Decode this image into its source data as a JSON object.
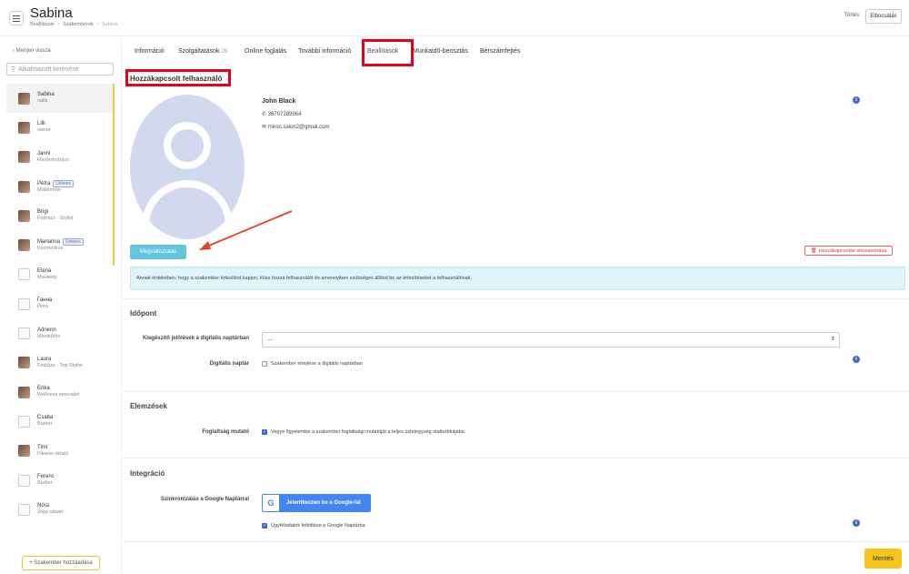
{
  "header": {
    "title": "Sabina",
    "breadcrumbs": [
      "Beállítások",
      "Szakemberek",
      "Sabina"
    ],
    "delete_label": "Törlés",
    "dismiss_label": "Elbocsátás"
  },
  "sidebar": {
    "back_label": "Menjen vissza",
    "search_placeholder": "Alkalmazott keresése",
    "add_label": "+ Szakember hozzáadása",
    "employees": [
      {
        "name": "Sabina",
        "role": "nails",
        "badge": "",
        "photo": true,
        "active": true
      },
      {
        "name": "Lilli",
        "role": "owner",
        "badge": "",
        "photo": true
      },
      {
        "name": "Janni",
        "role": "Mesterfodrász",
        "badge": "",
        "photo": true
      },
      {
        "name": "Petra",
        "role": "Műkörmös",
        "badge": "Üzletes",
        "photo": true
      },
      {
        "name": "Brigi",
        "role": "Fodrász - Stylist",
        "badge": "",
        "photo": true
      },
      {
        "name": "Marianna",
        "role": "Kozmetikus",
        "badge": "Üzletes",
        "photo": true
      },
      {
        "name": "Elena",
        "role": "Манікюр",
        "badge": "",
        "photo": false
      },
      {
        "name": "Ганна",
        "role": "Йога",
        "badge": "",
        "photo": false
      },
      {
        "name": "Adrienn",
        "role": "Manikűrös",
        "badge": "",
        "photo": false
      },
      {
        "name": "Laura",
        "role": "Fodrász - Top Stylist",
        "badge": "",
        "photo": true
      },
      {
        "name": "Erika",
        "role": "Wellness specialist",
        "badge": "",
        "photo": true
      },
      {
        "name": "Csaba",
        "role": "Barber",
        "badge": "",
        "photo": false
      },
      {
        "name": "Timi",
        "role": "Fitness oktató",
        "badge": "",
        "photo": true
      },
      {
        "name": "Ferenc",
        "role": "Barber",
        "badge": "",
        "photo": false
      },
      {
        "name": "Nóra",
        "role": "Jóga oktató",
        "badge": "",
        "photo": false
      }
    ]
  },
  "tabs": [
    {
      "label": "Információ",
      "count": ""
    },
    {
      "label": "Szolgáltatások",
      "count": "29"
    },
    {
      "label": "Online foglalás",
      "count": ""
    },
    {
      "label": "További információ",
      "count": ""
    },
    {
      "label": "Beállítások",
      "count": "",
      "active": true
    },
    {
      "label": "Munkaidő-beosztás",
      "count": ""
    },
    {
      "label": "Bérszámfejtés",
      "count": ""
    }
  ],
  "linked_user": {
    "section_title": "Hozzákapcsolt felhasználó",
    "name": "John Black",
    "phone": "36707289964",
    "email": "miron.salon2@gmail.com",
    "change_label": "Megváltoztatás",
    "unlink_label": "Hozzákapcsolás visszavonása",
    "notice": "Annak érdekében, hogy a szakember értesítést kapjon, köss hozzá felhasználót és amennyiben szükséges állítsd be az értesítéseket a felhasználónak."
  },
  "appointment": {
    "title": "Időpont",
    "extra_marks_label": "Kiegészítő jelölések a digitális naptárban",
    "extra_marks_value": "---",
    "digital_calendar_label": "Digitális naptár",
    "hide_label": "Szakember elrejtése a digitális naptárban",
    "hide_checked": false
  },
  "analytics": {
    "title": "Elemzések",
    "occupancy_label": "Foglaltság mutató",
    "occupancy_text": "Vegye figyelembe a szakember foglaltsági mutatóját a teljes üzletegység statisztikájába",
    "occupancy_checked": true
  },
  "integration": {
    "title": "Integráció",
    "sync_label": "Szinkronizálás a Google Naptárral",
    "google_button": "Jelentkezzen be a Google-lal",
    "google_letter": "G",
    "upload_text": "Ügyféladatok feltöltése a Google Naptárba",
    "upload_checked": true
  },
  "footer": {
    "save_label": "Mentés"
  },
  "colors": {
    "accent": "#f7c51b",
    "highlight_box": "#e6001e",
    "info": "#3b6dc4",
    "change_button": "#63c7e0"
  }
}
